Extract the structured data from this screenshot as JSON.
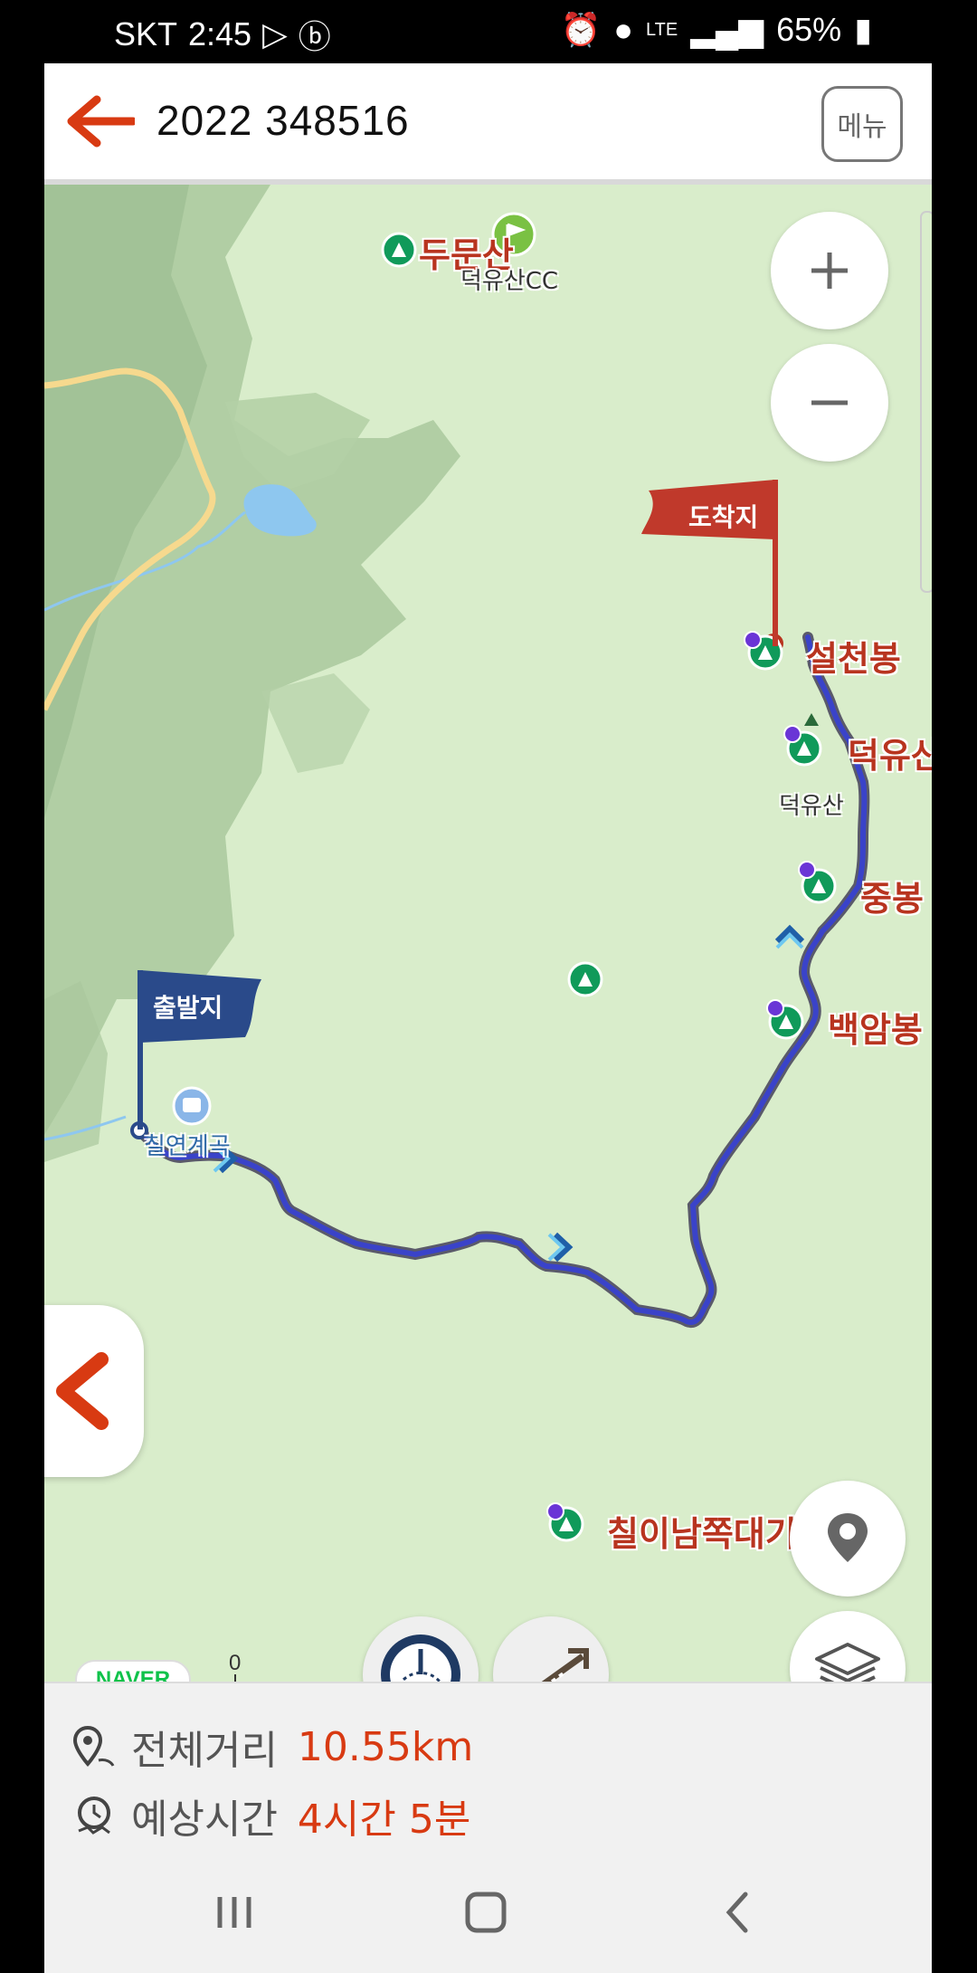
{
  "status_bar": {
    "carrier": "SKT",
    "time": "2:45",
    "network": "LTE",
    "battery": "65%"
  },
  "header": {
    "title": "2022 348516",
    "menu_label": "메뉴"
  },
  "map": {
    "peaks": [
      {
        "name": "두문산",
        "sub": "덕유산CC"
      },
      {
        "name": "설천봉"
      },
      {
        "name": "덕유산",
        "sub": "덕유산"
      },
      {
        "name": "중봉"
      },
      {
        "name": "백암봉"
      },
      {
        "name": "칠이남쪽대기봉"
      }
    ],
    "poi": {
      "start_poi": "칠연계곡"
    },
    "flags": {
      "start": "출발지",
      "end": "도착지"
    },
    "attribution": "NAVER",
    "scale_zero": "0"
  },
  "info": {
    "distance_label": "전체거리",
    "distance_value": "10.55km",
    "time_label": "예상시간",
    "time_value": "4시간 5분"
  },
  "colors": {
    "accent": "#d83a12",
    "route": "#3a43c9",
    "map_bg": "#d9edcb",
    "peak_label": "#b8341f",
    "start_flag": "#2a4a8a",
    "end_flag": "#c0392b"
  },
  "icons": [
    "back-arrow-icon",
    "zoom-in-icon",
    "zoom-out-icon",
    "location-icon",
    "layers-icon",
    "speed-gauge-icon",
    "elevation-icon",
    "distance-pin-icon",
    "clock-icon",
    "recent-apps-icon",
    "home-icon",
    "nav-back-icon"
  ]
}
